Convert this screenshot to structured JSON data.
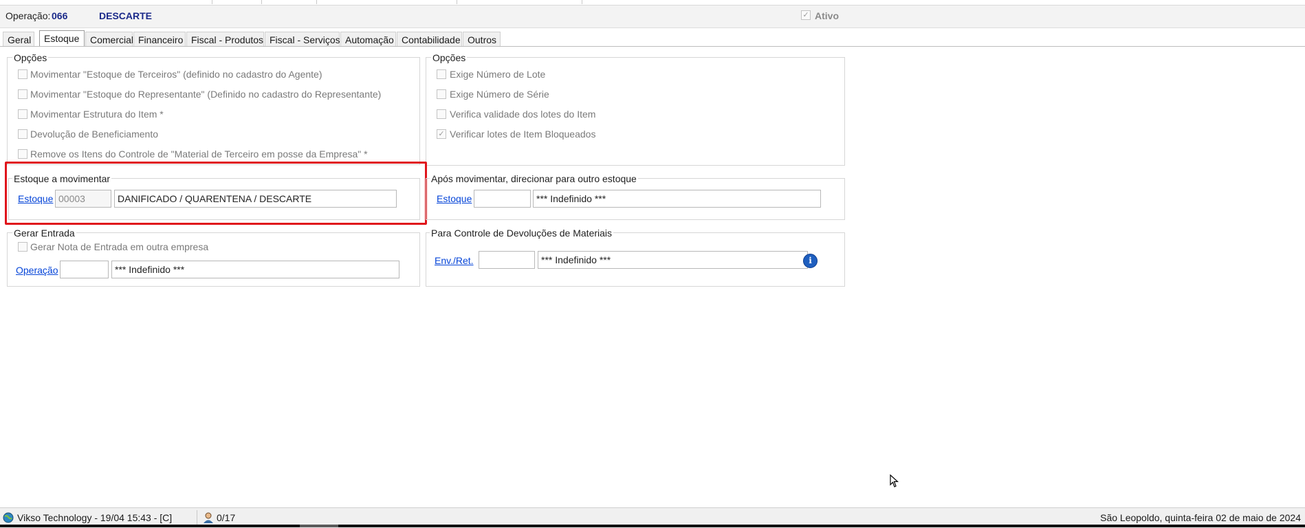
{
  "header": {
    "operation_label": "Operação:",
    "operation_code": "066",
    "operation_name": "DESCARTE",
    "active_label": "Ativo"
  },
  "tabs": [
    {
      "label": "Geral"
    },
    {
      "label": "Estoque"
    },
    {
      "label": "Comercial"
    },
    {
      "label": "Financeiro"
    },
    {
      "label": "Fiscal - Produtos"
    },
    {
      "label": "Fiscal - Serviços"
    },
    {
      "label": "Automação"
    },
    {
      "label": "Contabilidade"
    },
    {
      "label": "Outros"
    }
  ],
  "active_tab": "Estoque",
  "left_options": {
    "legend": "Opções",
    "items": [
      {
        "label": "Movimentar \"Estoque de Terceiros\" (definido no cadastro do Agente)",
        "checked": false
      },
      {
        "label": "Movimentar \"Estoque do Representante\" (Definido no cadastro do Representante)",
        "checked": false
      },
      {
        "label": "Movimentar Estrutura do Item *",
        "checked": false
      },
      {
        "label": "Devolução de Beneficiamento",
        "checked": false
      },
      {
        "label": "Remove os Itens do Controle de \"Material de Terceiro em posse da Empresa\" *",
        "checked": false
      }
    ]
  },
  "right_options": {
    "legend": "Opções",
    "items": [
      {
        "label": "Exige Número de Lote",
        "checked": false
      },
      {
        "label": "Exige Número de Série",
        "checked": false
      },
      {
        "label": "Verifica validade dos lotes do Item",
        "checked": false
      },
      {
        "label": "Verificar lotes de Item Bloqueados",
        "checked": true
      }
    ]
  },
  "estoque_movimentar": {
    "legend": "Estoque a movimentar",
    "link": "Estoque",
    "code": "00003",
    "description": "DANIFICADO / QUARENTENA / DESCARTE"
  },
  "apos_movimentar": {
    "legend": "Após movimentar, direcionar para outro estoque",
    "link": "Estoque",
    "code": "",
    "description": "*** Indefinido ***"
  },
  "gerar_entrada": {
    "legend": "Gerar Entrada",
    "checkbox_label": "Gerar Nota de Entrada em outra empresa",
    "link": "Operação",
    "code": "",
    "description": "*** Indefinido ***"
  },
  "controle_devolucoes": {
    "legend": "Para Controle de Devoluções de Materiais",
    "link": "Env./Ret.",
    "code": "",
    "description": "*** Indefinido ***"
  },
  "statusbar": {
    "company": "Vikso Technology - 19/04 15:43 - [C]",
    "users": "0/17",
    "location_date": "São Leopoldo, quinta-feira 02 de maio de 2024"
  },
  "colors": {
    "highlight": "#e0141b",
    "link": "#0645d8",
    "operation_text": "#1b2a8a"
  }
}
